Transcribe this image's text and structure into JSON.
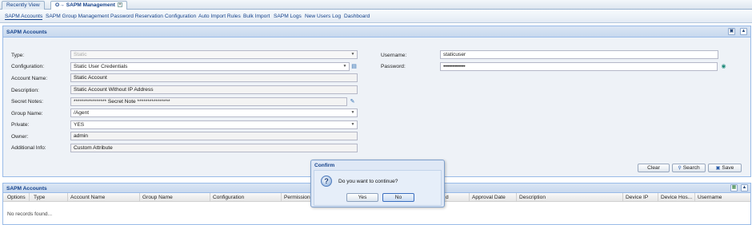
{
  "top_tabs": [
    {
      "label": "Recently View"
    },
    {
      "label": "SAPM Management",
      "key_glyph": "O→",
      "close": "×"
    }
  ],
  "subnav": [
    "SAPM Accounts",
    "SAPM Group Management",
    "Password Reservation",
    "Configuration",
    "Auto Import Rules",
    "Bulk Import",
    "SAPM Logs",
    "New Users Log",
    "Dashboard"
  ],
  "form_panel": {
    "title": "SAPM Accounts",
    "fields": {
      "type": {
        "label": "Type:",
        "value": "Static"
      },
      "configuration": {
        "label": "Configuration:",
        "value": "Static User Credentials"
      },
      "account_name": {
        "label": "Account Name:",
        "value": "Static Account"
      },
      "description": {
        "label": "Description:",
        "value": "Static Account Without IP Address"
      },
      "secret_notes": {
        "label": "Secret Notes:",
        "value": "**************** Secret Note ****************"
      },
      "group_name": {
        "label": "Group Name:",
        "value": "/Agent"
      },
      "private": {
        "label": "Private:",
        "value": "YES"
      },
      "owner": {
        "label": "Owner:",
        "value": "admin"
      },
      "additional_info": {
        "label": "Additional Info:",
        "value": "Custom Attribute"
      },
      "username": {
        "label": "Username:",
        "value": "staticuser"
      },
      "password": {
        "label": "Password:",
        "value": "•••••••••••••••"
      }
    },
    "buttons": {
      "clear": "Clear",
      "search": "Search",
      "save": "Save"
    }
  },
  "grid_panel": {
    "title": "SAPM Accounts",
    "columns": [
      "Options",
      "Type",
      "Account Name",
      "Group Name",
      "Configuration",
      "Permission",
      "d",
      "Approval Date",
      "Description",
      "Device IP",
      "Device Hos...",
      "Username"
    ],
    "empty_text": "No records found..."
  },
  "dialog": {
    "title": "Confirm",
    "message": "Do you want to continue?",
    "icon": "?",
    "yes": "Yes",
    "no": "No"
  },
  "colors": {
    "accent": "#15428b",
    "panel_border": "#99bbe8",
    "header_bg": "#c7d8ee"
  }
}
